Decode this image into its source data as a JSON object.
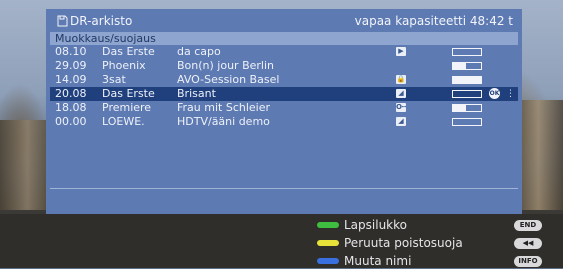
{
  "header": {
    "title": "DR-arkisto",
    "capacity": "vapaa kapasiteetti 48:42 t"
  },
  "subheader": "Muokkaus/suojaus",
  "recordings": [
    {
      "time": "08.10",
      "channel": "Das Erste",
      "title": "da capo",
      "icon": "play-icon",
      "icon_glyph": "▶",
      "progress": 0.0,
      "selected": false
    },
    {
      "time": "29.09",
      "channel": "Phoenix",
      "title": "Bon(n) jour Berlin",
      "icon": "",
      "icon_glyph": "",
      "progress": 0.45,
      "selected": false
    },
    {
      "time": "14.09",
      "channel": "3sat",
      "title": "AVO-Session Basel",
      "icon": "lock-icon",
      "icon_glyph": "🔒",
      "progress": 1.0,
      "selected": false
    },
    {
      "time": "20.08",
      "channel": "Das Erste",
      "title": "Brisant",
      "icon": "erase-icon",
      "icon_glyph": "◢",
      "progress": 0.0,
      "selected": true
    },
    {
      "time": "18.08",
      "channel": "Premiere",
      "title": "Frau mit Schleier",
      "icon": "key-icon",
      "icon_glyph": "O┅",
      "progress": 0.45,
      "selected": false
    },
    {
      "time": "00.00",
      "channel": "LOEWE.",
      "title": "HDTV/ääni demo",
      "icon": "erase-icon",
      "icon_glyph": "◢",
      "progress": 0.0,
      "selected": false
    }
  ],
  "selected_controls": {
    "ok": "OK",
    "updown": "⋮"
  },
  "legend": [
    {
      "label": "Lapsilukko",
      "color": "#3fbf3f",
      "key": "END"
    },
    {
      "label": "Peruuta poistosuoja",
      "color": "#e6e23a",
      "key": "◀◀"
    },
    {
      "label": "Muuta nimi",
      "color": "#3a6fe0",
      "key": "INFO"
    }
  ]
}
